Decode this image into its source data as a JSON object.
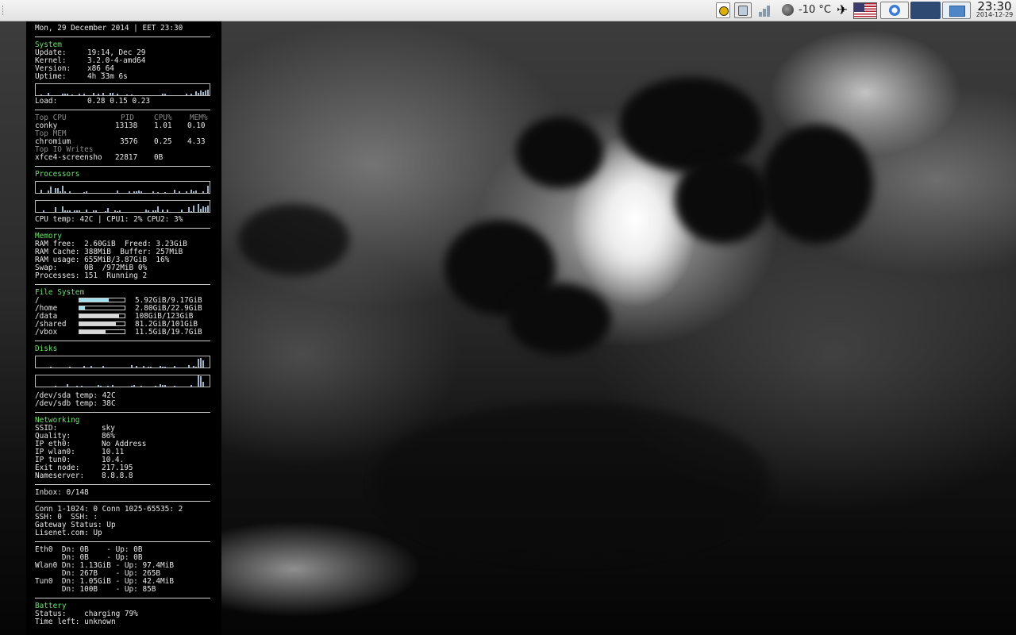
{
  "panel": {
    "temperature": "-10 °C",
    "clock_time": "23:30",
    "clock_date": "2014-12-29",
    "icons": [
      "conky-icon",
      "flash-drive-icon",
      "network-signal-icon",
      "weather-icon",
      "airplane-icon",
      "us-flag-icon",
      "browser-task-icon",
      "desktop-task-icon"
    ]
  },
  "conky": {
    "header": "Mon, 29 December 2014 | EET 23:30",
    "system": {
      "title": "System",
      "rows": [
        {
          "label": "Update:",
          "value": "19:14, Dec 29"
        },
        {
          "label": "Kernel:",
          "value": "3.2.0-4-amd64"
        },
        {
          "label": "Version:",
          "value": "x86_64"
        },
        {
          "label": "Uptime:",
          "value": "4h 33m 6s"
        }
      ],
      "load_label": "Load:",
      "load_value": "0.28 0.15 0.23"
    },
    "top": {
      "cpu_title": "Top CPU",
      "col_pid": "PID",
      "col_cpu": "CPU%",
      "col_mem": "MEM%",
      "cpu_row": {
        "name": "conky",
        "pid": "13138",
        "cpu": "1.01",
        "mem": "0.10"
      },
      "mem_title": "Top MEM",
      "mem_row": {
        "name": "chromium",
        "pid": "3576",
        "cpu": "0.25",
        "mem": "4.33"
      },
      "io_title": "Top IO Writes",
      "io_row": {
        "name": "xfce4-screensho",
        "pid": "22817",
        "value": "0B"
      }
    },
    "processors": {
      "title": "Processors",
      "temp_line": "CPU temp: 42C | CPU1: 2% CPU2: 3%"
    },
    "memory": {
      "title": "Memory",
      "lines": [
        "RAM free:  2.60GiB  Freed: 3.23GiB",
        "RAM Cache: 388MiB  Buffer: 257MiB",
        "RAM usage: 655MiB/3.87GiB  16%",
        "Swap:      0B  /972MiB 0%",
        "Processes: 151  Running 2"
      ]
    },
    "filesystem": {
      "title": "File System",
      "mounts": [
        {
          "path": "/",
          "value": "5.92GiB/9.17GiB",
          "fill": 0.65
        },
        {
          "path": "/home",
          "value": "2.80GiB/22.9GiB",
          "fill": 0.12
        },
        {
          "path": "/data",
          "value": "108GiB/123GiB",
          "fill": 0.88
        },
        {
          "path": "/shared",
          "value": "81.2GiB/101GiB",
          "fill": 0.8
        },
        {
          "path": "/vbox",
          "value": "11.5GiB/19.7GiB",
          "fill": 0.58
        }
      ]
    },
    "disks": {
      "title": "Disks",
      "sda": "/dev/sda temp: 42C",
      "sdb": "/dev/sdb temp: 38C"
    },
    "networking": {
      "title": "Networking",
      "rows": [
        {
          "label": "SSID:",
          "value": "sky"
        },
        {
          "label": "Quality:",
          "value": "86%"
        },
        {
          "label": "IP eth0:",
          "value": "No Address"
        },
        {
          "label": "IP wlan0:",
          "value": "10.11"
        },
        {
          "label": "IP tun0:",
          "value": "10.4."
        },
        {
          "label": "Exit node:",
          "value": "217.195"
        },
        {
          "label": "Nameserver:",
          "value": "8.8.8.8"
        }
      ]
    },
    "inbox": "Inbox: 0/148",
    "connections": [
      "Conn 1-1024: 0 Conn 1025-65535: 2",
      "SSH: 0  SSH: :",
      "Gateway Status: Up",
      "Lisenet.com: Up"
    ],
    "traffic": [
      "Eth0  Dn: 0B    - Up: 0B",
      "      Dn: 0B    - Up: 0B",
      "Wlan0 Dn: 1.13GiB - Up: 97.4MiB",
      "      Dn: 267B    - Up: 265B",
      "Tun0  Dn: 1.05GiB - Up: 42.4MiB",
      "      Dn: 100B    - Up: 85B"
    ],
    "battery": {
      "title": "Battery",
      "status": "Status:    charging 79%",
      "time_left": "Time left: unknown"
    }
  }
}
